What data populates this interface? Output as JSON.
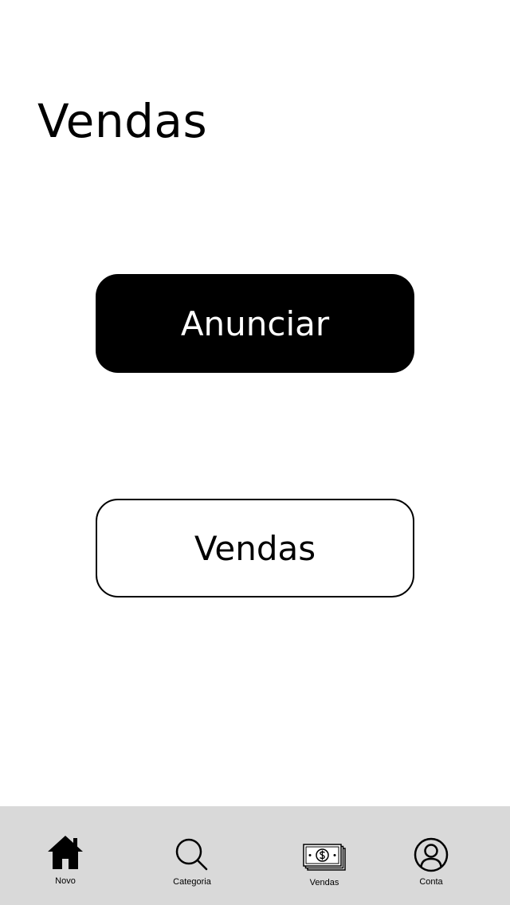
{
  "header": {
    "title": "Vendas"
  },
  "actions": {
    "primary_label": "Anunciar",
    "secondary_label": "Vendas"
  },
  "tab_bar": {
    "items": [
      {
        "label": "Novo",
        "icon": "home-icon"
      },
      {
        "label": "Categoria",
        "icon": "search-icon"
      },
      {
        "label": "Vendas",
        "icon": "money-icon"
      },
      {
        "label": "Conta",
        "icon": "user-icon"
      }
    ]
  },
  "colors": {
    "background": "#ffffff",
    "primary": "#000000",
    "tab_bar_background": "#d9d9d9"
  }
}
